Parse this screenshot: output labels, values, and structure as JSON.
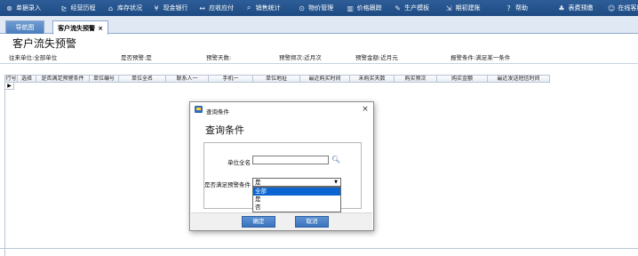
{
  "topbar": {
    "items": [
      {
        "icon": "scan-icon",
        "glyph": "⊗",
        "label": "单据录入"
      },
      {
        "icon": "chart-line-icon",
        "glyph": "⊵",
        "label": "经营历程"
      },
      {
        "icon": "warehouse-icon",
        "glyph": "⌂",
        "label": "库存状况"
      },
      {
        "icon": "bank-icon",
        "glyph": "¥",
        "label": "现金银行"
      },
      {
        "icon": "transfer-icon",
        "glyph": "↔",
        "label": "应收应付"
      },
      {
        "icon": "search-icon",
        "glyph": "⌕",
        "label": "销售统计"
      },
      {
        "icon": "price-icon",
        "glyph": "⊙",
        "label": "物价管理"
      },
      {
        "icon": "bar-chart-icon",
        "glyph": "▥",
        "label": "价格跟踪"
      },
      {
        "icon": "wrench-icon",
        "glyph": "✎",
        "label": "生产模板"
      },
      {
        "icon": "import-icon",
        "glyph": "⇲",
        "label": "期初建账"
      },
      {
        "icon": "help-icon",
        "glyph": "?",
        "label": "帮助"
      },
      {
        "icon": "user-icon",
        "glyph": "♣",
        "label": "表费预缴"
      },
      {
        "icon": "service-icon",
        "glyph": "☺",
        "label": "在线客服"
      }
    ]
  },
  "tabs": [
    {
      "label": "导航图"
    },
    {
      "label": "客户流失预警",
      "close": "×"
    }
  ],
  "page": {
    "title": "客户流失预警",
    "filters": [
      {
        "label": "往来单位:",
        "value": "全部单位"
      },
      {
        "label": "是否预警:",
        "value": "是"
      },
      {
        "label": "预警天数:",
        "value": ""
      },
      {
        "label": "预警频次:",
        "value": "近月次"
      },
      {
        "label": "预警金额:",
        "value": "近月元"
      },
      {
        "label": "报警条件:",
        "value": "满足某一条件"
      }
    ]
  },
  "grid": {
    "columns": [
      "行号",
      "选择",
      "是否满足预警条件",
      "单位编号",
      "单位全名",
      "联系人一",
      "手机一",
      "单位地址",
      "最近购买时间",
      "未购买天数",
      "购买频次",
      "购买金额",
      "最近发送短信时间"
    ],
    "current_row_marker": "▶"
  },
  "dialog": {
    "title": "查询条件",
    "heading": "查询条件",
    "unit_label": "单位全名",
    "unit_value": "",
    "condition_label": "是否满足预警条件",
    "condition_value": "是",
    "options": [
      "全部",
      "是",
      "否"
    ],
    "ok_label": "确定",
    "cancel_label": "取消",
    "close": "×"
  },
  "colors": {
    "topbar": "#1e4a82",
    "tab_active": "#ffffff",
    "button": "#3b72bd",
    "list_selected": "#0a64d2"
  }
}
